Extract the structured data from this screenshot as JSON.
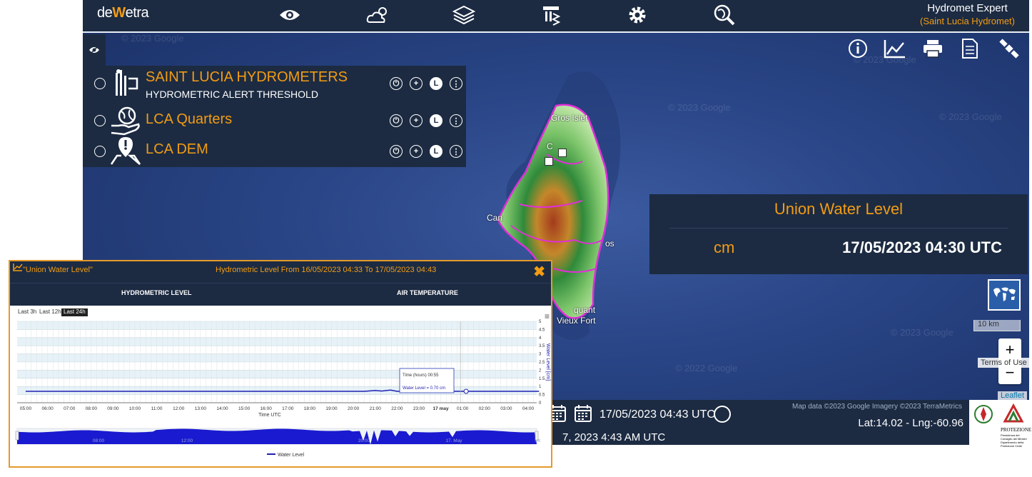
{
  "app": {
    "logo_left": "de",
    "logo_mid": "W",
    "logo_right": "etra",
    "user_name": "Hydromet Expert",
    "user_org": "(Saint Lucia Hydromet)"
  },
  "toolbar_icons": [
    "eye-icon",
    "weather-icon",
    "layers-icon",
    "hydro-library-icon",
    "gear-icon",
    "search-globe-icon"
  ],
  "right_tools": [
    "info-icon",
    "chart-icon",
    "print-icon",
    "document-icon",
    "satellite-icon"
  ],
  "layers": [
    {
      "title": "SAINT LUCIA HYDROMETERS",
      "subtitle": "HYDROMETRIC ALERT THRESHOLD",
      "icon": "hydrometer-icon"
    },
    {
      "title": "LCA Quarters",
      "subtitle": "",
      "icon": "globe-hand-icon"
    },
    {
      "title": "LCA DEM",
      "subtitle": "",
      "icon": "map-pin-icon"
    }
  ],
  "layer_controls": [
    "opacity-icon",
    "zoom-plus-icon",
    "L",
    "more-icon"
  ],
  "map": {
    "watermarks": [
      "© 2023 Google",
      "© 2023 Google",
      "© 2023 Google",
      "© 2022 Google",
      "© 2023 Google",
      "© 2023 Google"
    ],
    "labels": {
      "gros_islet": "Gros Islet",
      "castries": "C",
      "canaries": "Can",
      "dennery": "os",
      "micoud": "quant",
      "vieux_fort": "Vieux Fort"
    },
    "scale": "10 km",
    "zoom_in": "+",
    "zoom_out": "−",
    "terms": "Terms of Use",
    "leaflet": "Leaflet"
  },
  "info": {
    "title": "Union Water Level",
    "unit": "cm",
    "time": "17/05/2023 04:30 UTC"
  },
  "bottom": {
    "date": "17/05/2023 04:43 UTC",
    "now": "7, 2023 4:43 AM UTC",
    "attribution": "Map data ©2023 Google Imagery ©2023 TerraMetrics",
    "coords": "Lat:14.02 - Lng:-60.96"
  },
  "logos": {
    "agency": "PROTEZIONE CIVILE",
    "agency_sub": "Presidenza del Consiglio dei Ministri Dipartimento della Protezione Civile"
  },
  "chart_window": {
    "title": "\"Union Water Level\"",
    "range": "Hydrometric Level From 16/05/2023 04:33 To 17/05/2023 04:43",
    "close": "✖",
    "tab_hydro": "HYDROMETRIC LEVEL",
    "tab_air": "AIR TEMPERATURE",
    "range_buttons": [
      "Last 3h",
      "Last 12h",
      "Last 24h"
    ],
    "menu": "≡"
  },
  "chart_data": {
    "type": "line",
    "xlabel": "Time UTC",
    "ylabel": "Water Level [cm]",
    "x_ticks": [
      "05:00",
      "06:00",
      "07:00",
      "08:00",
      "09:00",
      "10:00",
      "11:00",
      "12:00",
      "13:00",
      "14:00",
      "15:00",
      "16:00",
      "17:00",
      "18:00",
      "19:00",
      "20:00",
      "21:00",
      "22:00",
      "23:00",
      "17 may",
      "01:00",
      "02:00",
      "03:00",
      "04:00"
    ],
    "y_ticks": [
      "5",
      "4.5",
      "4",
      "3.5",
      "3",
      "2.5",
      "2",
      "1.5",
      "1",
      "0.5",
      "0"
    ],
    "ylim": [
      0,
      5
    ],
    "series": [
      {
        "name": "Water Level",
        "color": "#1f1fb0",
        "x": [
          0,
          15.5,
          16,
          16.3,
          16.7,
          17,
          19,
          20,
          23.5
        ],
        "values": [
          0.7,
          0.7,
          0.75,
          0.72,
          0.78,
          0.7,
          0.7,
          0.7,
          0.7
        ]
      }
    ],
    "tooltip": {
      "line1": "Time (hours) 00:55",
      "line2": "Water Level = 0.70 cm"
    },
    "navigator_ticks": [
      "08:00",
      "12:00",
      "20:00",
      "17. May",
      "04:"
    ],
    "legend": "Water Level"
  }
}
